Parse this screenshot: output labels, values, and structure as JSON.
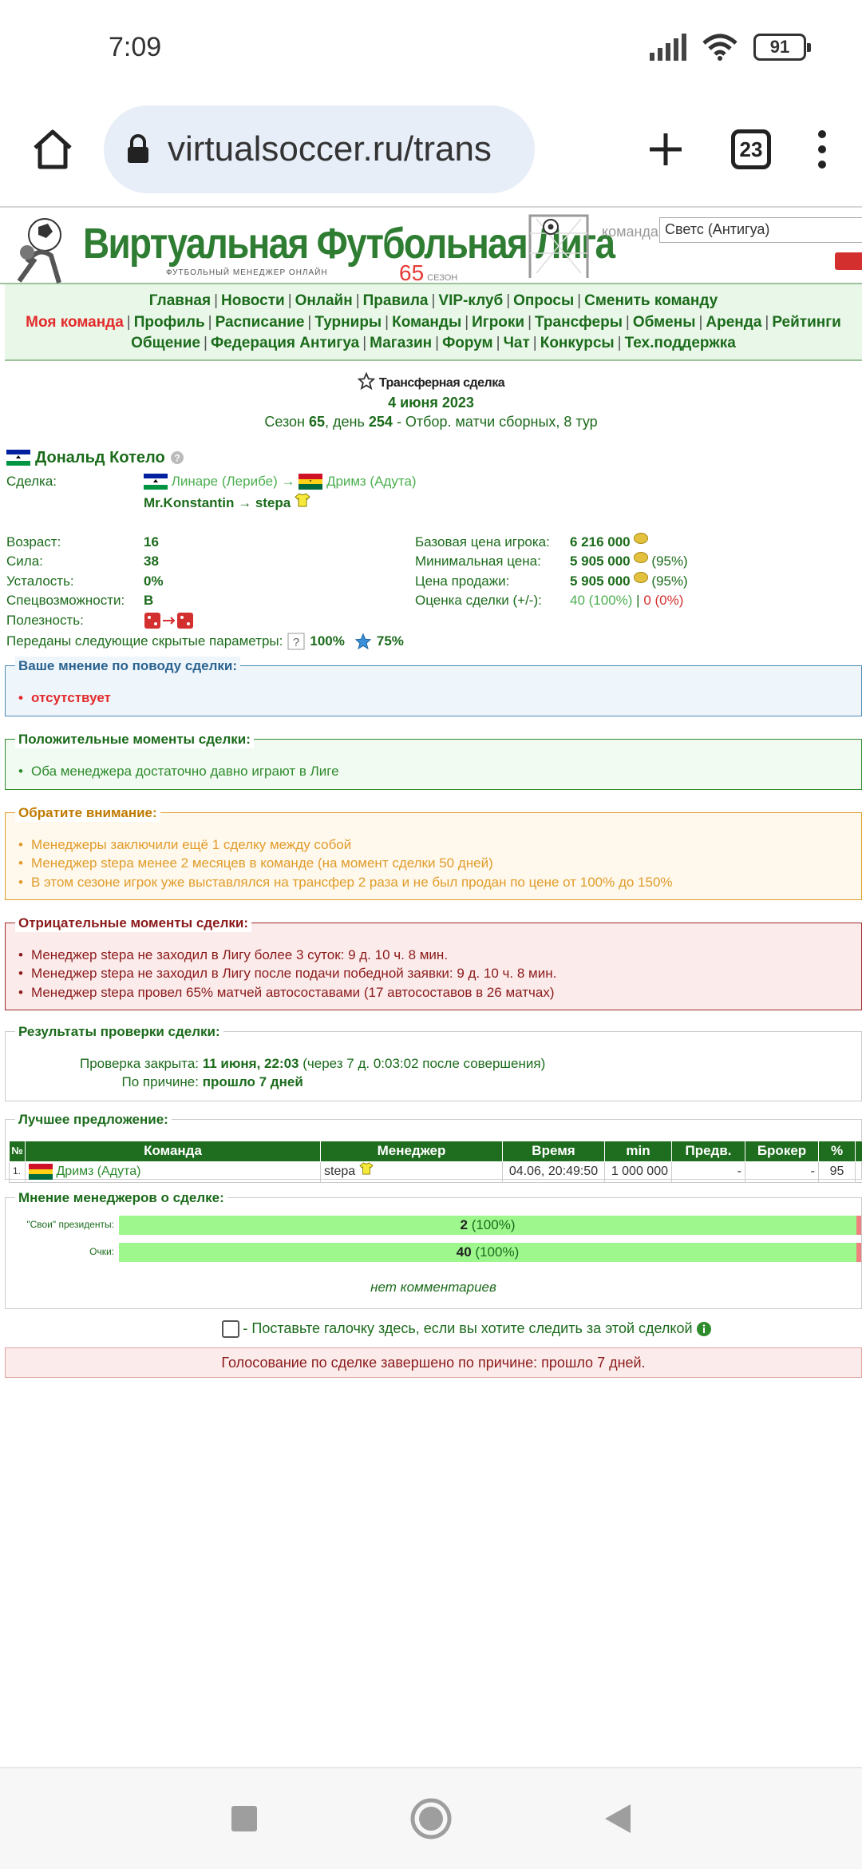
{
  "status_bar": {
    "time": "7:09",
    "battery": "91"
  },
  "browser": {
    "url": "virtualsoccer.ru/trans",
    "tab_count": "23"
  },
  "header": {
    "logo_title": "Виртуальная Футбольная Лига",
    "logo_subtitle": "ФУТБОЛЬНЫЙ МЕНЕДЖЕР ОНЛАЙН",
    "season_number": "65",
    "season_word": "СЕЗОН",
    "team_label": "команда",
    "team_value": "Светс (Антигуа)"
  },
  "nav": {
    "row1": [
      "Главная",
      "Новости",
      "Онлайн",
      "Правила",
      "VIP-клуб",
      "Опросы",
      "Сменить команду"
    ],
    "row2_first": "Моя команда",
    "row2": [
      "Профиль",
      "Расписание",
      "Турниры",
      "Команды",
      "Игроки",
      "Трансферы",
      "Обмены",
      "Аренда",
      "Рейтинги"
    ],
    "row3": [
      "Общение",
      "Федерация Антигуа",
      "Магазин",
      "Форум",
      "Чат",
      "Конкурсы",
      "Тех.поддержка"
    ]
  },
  "deal": {
    "title": "Трансферная сделка",
    "date": "4 июня 2023",
    "season_prefix": "Сезон",
    "season": "65",
    "day_prefix": ", день",
    "day": "254",
    "round_info": "- Отбор. матчи сборных, 8 тур"
  },
  "player": {
    "name": "Дональд Котело",
    "deal_label": "Сделка:",
    "from_team": "Линаре (Лерибе)",
    "arrow": "→",
    "to_team": "Дримз (Адута)",
    "from_manager": "Mr.Konstantin",
    "to_manager": "stepa",
    "stats": [
      {
        "label": "Возраст:",
        "value": "16"
      },
      {
        "label": "Сила:",
        "value": "38"
      },
      {
        "label": "Усталость:",
        "value": "0%"
      },
      {
        "label": "Спецвозможности:",
        "value": "В"
      },
      {
        "label": "Полезность:",
        "value": ""
      }
    ],
    "prices": [
      {
        "label": "Базовая цена игрока:",
        "value": "6 216 000",
        "extra": ""
      },
      {
        "label": "Минимальная цена:",
        "value": "5 905 000",
        "extra": "(95%)"
      },
      {
        "label": "Цена продажи:",
        "value": "5 905 000",
        "extra": "(95%)"
      }
    ],
    "assessment_label": "Оценка сделки (+/-):",
    "assessment_pos": "40 (100%)",
    "assessment_sep": "|",
    "assessment_neg": "0 (0%)",
    "hidden_label": "Переданы следующие скрытые параметры:",
    "hidden_q": "100%",
    "hidden_star": "75%"
  },
  "opinion": {
    "legend": "Ваше мнение по поводу сделки:",
    "items": [
      "отсутствует"
    ]
  },
  "positive": {
    "legend": "Положительные моменты сделки:",
    "items": [
      "Оба менеджера достаточно давно играют в Лиге"
    ]
  },
  "attention": {
    "legend": "Обратите внимание:",
    "items": [
      "Менеджеры заключили ещё 1 сделку между собой",
      "Менеджер stepa менее 2 месяцев в команде (на момент сделки 50 дней)",
      "В этом сезоне игрок уже выставлялся на трансфер 2 раза и не был продан по цене от 100% до 150%"
    ]
  },
  "negative": {
    "legend": "Отрицательные моменты сделки:",
    "items": [
      "Менеджер stepa не заходил в Лигу более 3 суток: 9 д. 10 ч. 8 мин.",
      "Менеджер stepa не заходил в Лигу после подачи победной заявки: 9 д. 10 ч. 8 мин.",
      "Менеджер stepa провел 65% матчей автосоставами (17 автосоставов в 26 матчах)"
    ]
  },
  "check": {
    "legend": "Результаты проверки сделки:",
    "closed_label": "Проверка закрыта:",
    "closed_value": "11 июня, 22:03",
    "closed_note": "(через 7 д. 0:03:02 после совершения)",
    "reason_label": "По причине:",
    "reason_value": "прошло 7 дней"
  },
  "best_offer": {
    "legend": "Лучшее предложение:",
    "columns": [
      "№",
      "Команда",
      "Менеджер",
      "Время",
      "min",
      "Предв.",
      "Брокер",
      "%"
    ],
    "rows": [
      {
        "n": "1.",
        "team": "Дримз (Адута)",
        "manager": "stepa",
        "time": "04.06, 20:49:50",
        "min": "1 000 000",
        "prev": "-",
        "broker": "-",
        "pct": "95"
      }
    ]
  },
  "managers_opinion": {
    "legend": "Мнение менеджеров о сделке:",
    "rows": [
      {
        "label": "\"Свои\" президенты:",
        "value": "2",
        "pct": "(100%)"
      },
      {
        "label": "Очки:",
        "value": "40",
        "pct": "(100%)"
      }
    ],
    "no_comments": "нет комментариев"
  },
  "watch_label": "- Поставьте галочку здесь, если вы хотите следить за этой сделкой",
  "vote_finished": "Голосование по сделке завершено по причине: прошло 7 дней.",
  "colors": {
    "green": "#1b6b1b",
    "red": "#e32b2b",
    "orange": "#e09c2b",
    "darkred": "#8b1a1a",
    "blue": "#2b6390"
  }
}
